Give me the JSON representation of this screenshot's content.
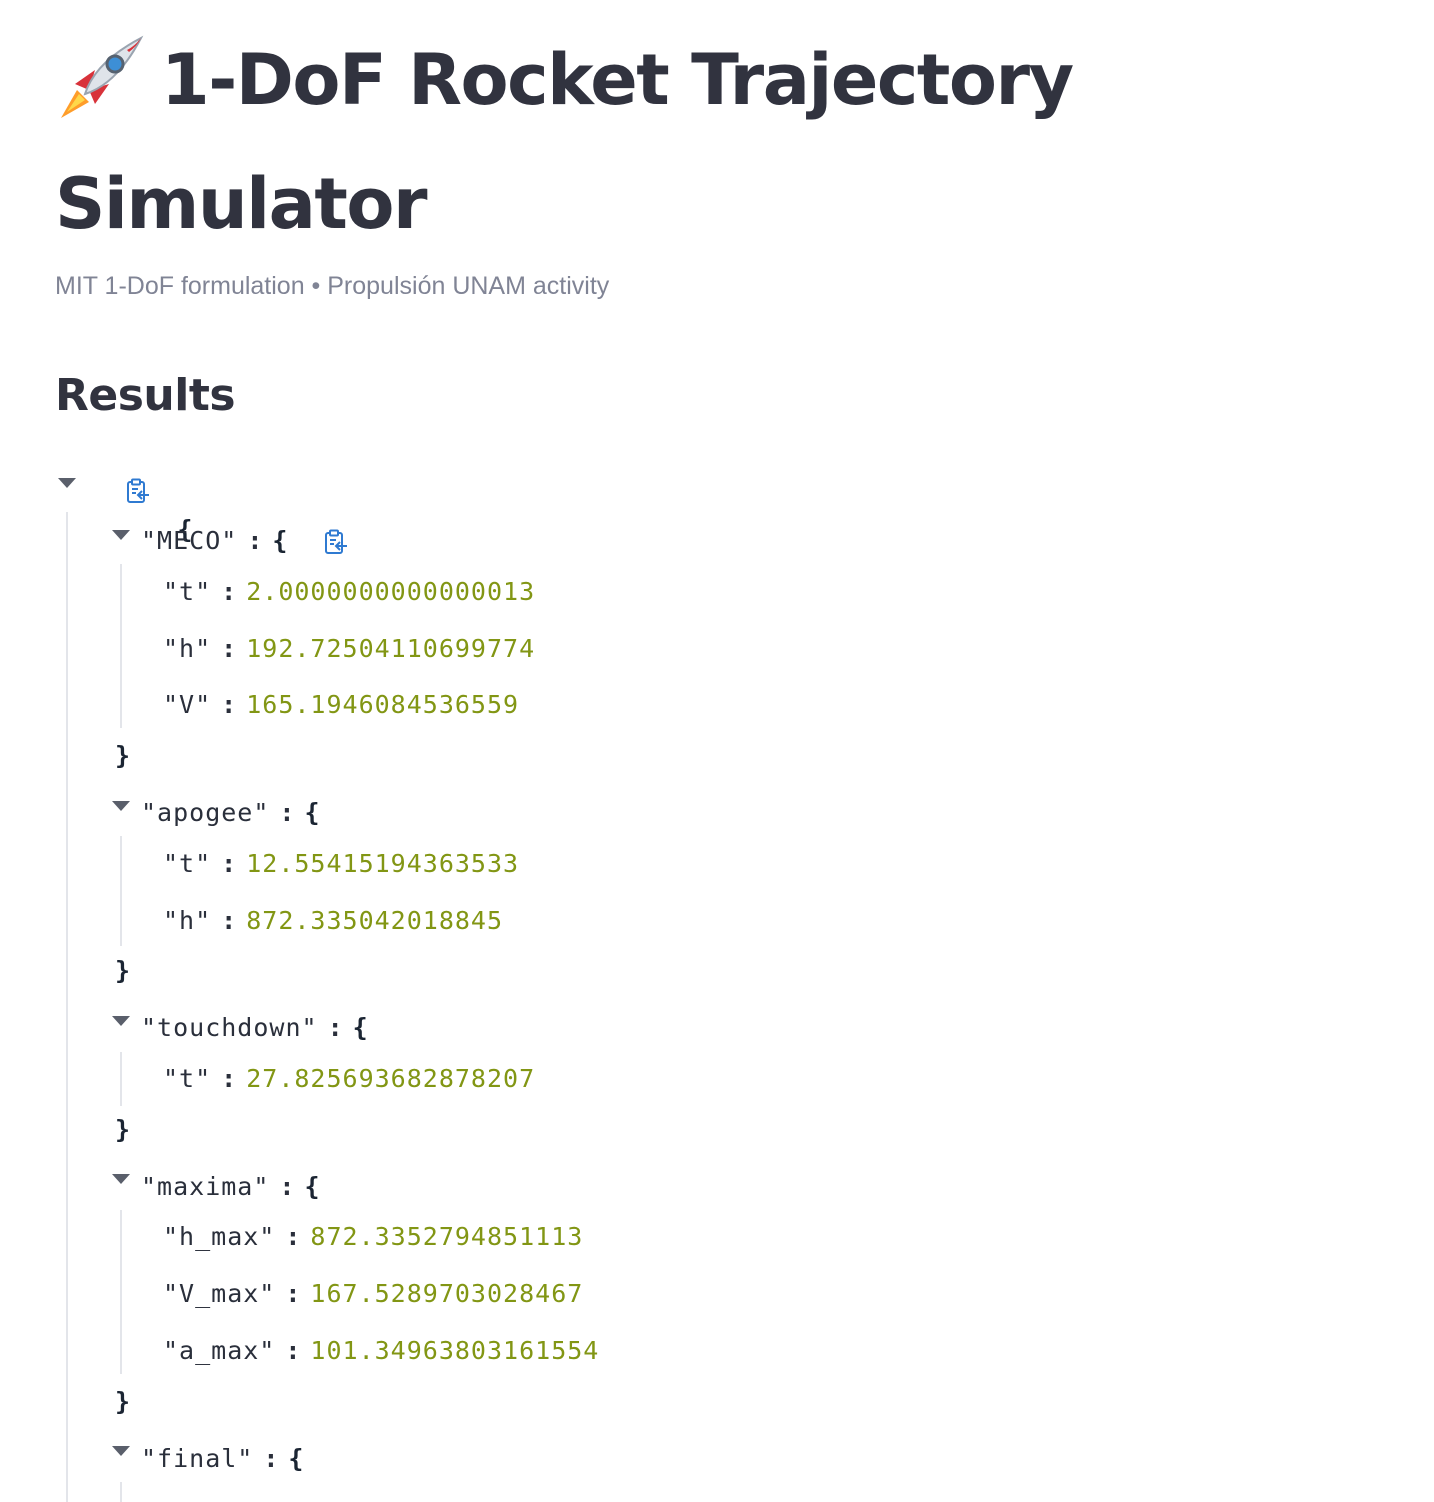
{
  "header": {
    "title_icon": "rocket-icon",
    "title": "1-DoF Rocket Trajectory Simulator",
    "caption": "MIT 1-DoF formulation • Propulsión UNAM activity"
  },
  "results": {
    "heading": "Results",
    "root_open": "{",
    "meco": {
      "key": "\"MECO\"",
      "open": "{",
      "t_key": "\"t\"",
      "t_val": "2.0000000000000013",
      "h_key": "\"h\"",
      "h_val": "192.72504110699774",
      "v_key": "\"V\"",
      "v_val": "165.1946084536559",
      "close": "}"
    },
    "apogee": {
      "key": "\"apogee\"",
      "open": "{",
      "t_key": "\"t\"",
      "t_val": "12.55415194363533",
      "h_key": "\"h\"",
      "h_val": "872.335042018845",
      "close": "}"
    },
    "touchdown": {
      "key": "\"touchdown\"",
      "open": "{",
      "t_key": "\"t\"",
      "t_val": "27.825693682878207",
      "close": "}"
    },
    "maxima": {
      "key": "\"maxima\"",
      "open": "{",
      "hmax_key": "\"h_max\"",
      "hmax_val": "872.3352794851113",
      "vmax_key": "\"V_max\"",
      "vmax_val": "167.5289703028467",
      "amax_key": "\"a_max\"",
      "amax_val": "101.34963803161554",
      "close": "}"
    },
    "final": {
      "key": "\"final\"",
      "open": "{"
    },
    "colon": ":"
  }
}
